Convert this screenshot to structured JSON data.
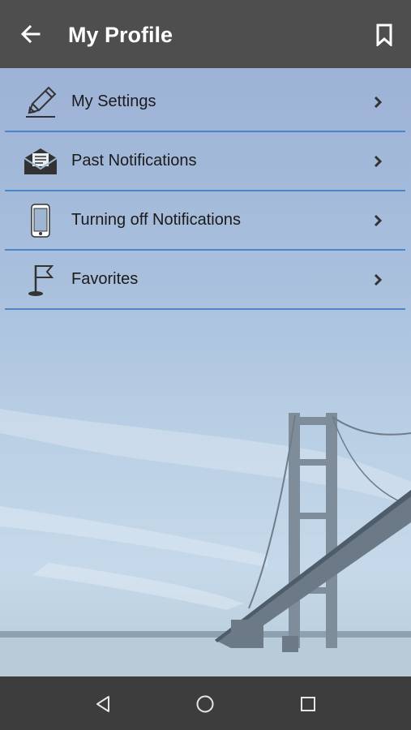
{
  "app_bar": {
    "title": "My Profile",
    "back_icon": "arrow-left-icon",
    "bookmark_icon": "bookmark-icon",
    "background": "#4e4e4e"
  },
  "menu": {
    "items": [
      {
        "label": "My Settings",
        "icon": "pencil-icon"
      },
      {
        "label": "Past Notifications",
        "icon": "envelope-icon"
      },
      {
        "label": "Turning off Notifications",
        "icon": "phone-icon"
      },
      {
        "label": "Favorites",
        "icon": "flag-icon"
      }
    ],
    "divider_color": "#4a86c8"
  },
  "nav_bar": {
    "back_icon": "triangle-back-icon",
    "home_icon": "circle-home-icon",
    "recents_icon": "square-recents-icon",
    "background": "#3d3d3d"
  }
}
